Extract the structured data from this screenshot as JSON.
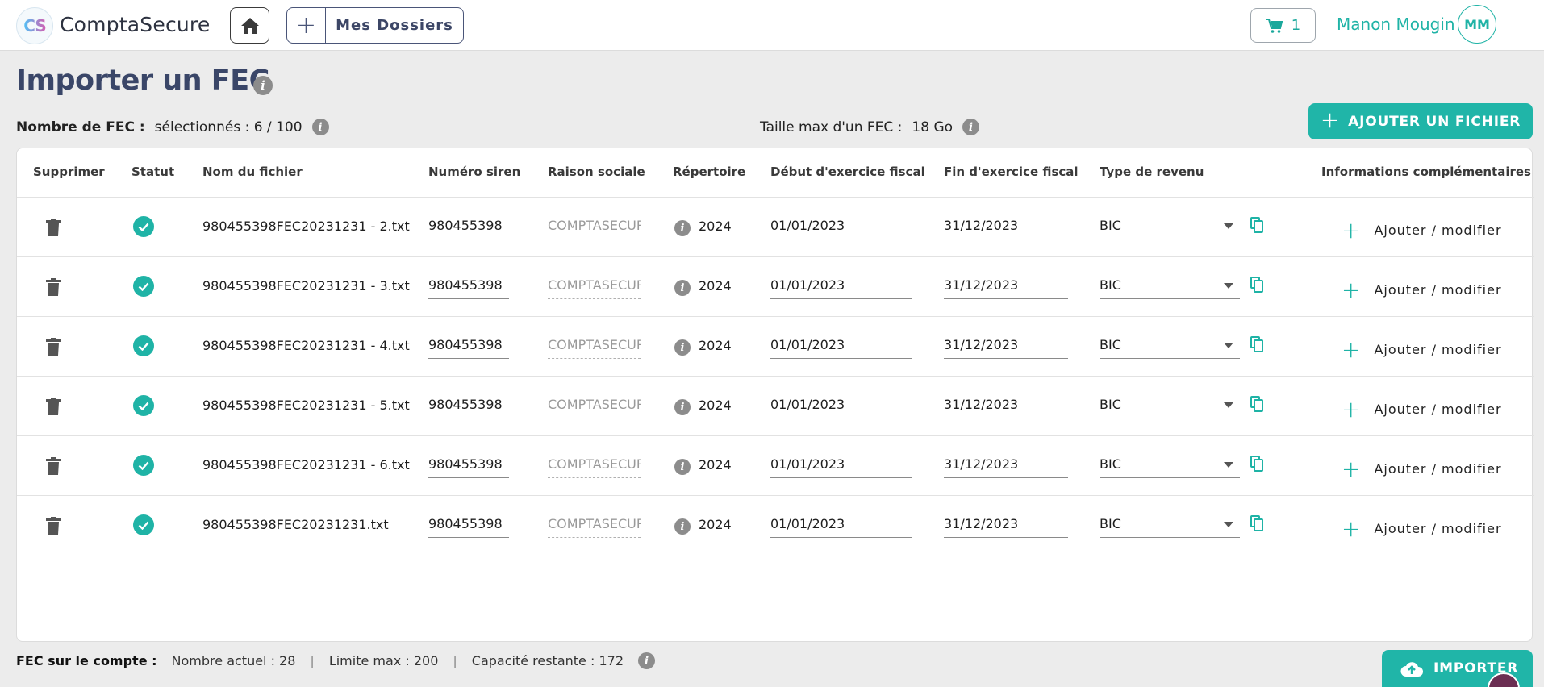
{
  "header": {
    "logo_text": "CS",
    "brand": "ComptaSecure",
    "dossiers_label": "Mes Dossiers",
    "cart_count": "1",
    "user_name": "Manon Mougin",
    "user_initials": "MM"
  },
  "page": {
    "title": "Importer un FEC",
    "fec_count_label": "Nombre de FEC :",
    "fec_count_value": "sélectionnés : 6 / 100",
    "max_size_label": "Taille max d'un FEC :",
    "max_size_value": "18 Go",
    "add_file_label": "AJOUTER UN FICHIER"
  },
  "table": {
    "headers": {
      "delete": "Supprimer",
      "status": "Statut",
      "filename": "Nom du fichier",
      "siren": "Numéro siren",
      "raison": "Raison sociale",
      "repertoire": "Répertoire",
      "debut": "Début d'exercice fiscal",
      "fin": "Fin d'exercice fiscal",
      "revenu": "Type de revenu",
      "infos": "Informations complémentaires"
    },
    "rows": [
      {
        "filename": "980455398FEC20231231 - 2.txt",
        "siren": "980455398",
        "raison": "COMPTASECURE",
        "repertoire": "2024",
        "debut": "01/01/2023",
        "fin": "31/12/2023",
        "revenu": "BIC",
        "action": "Ajouter / modifier"
      },
      {
        "filename": "980455398FEC20231231 - 3.txt",
        "siren": "980455398",
        "raison": "COMPTASECURE",
        "repertoire": "2024",
        "debut": "01/01/2023",
        "fin": "31/12/2023",
        "revenu": "BIC",
        "action": "Ajouter / modifier"
      },
      {
        "filename": "980455398FEC20231231 - 4.txt",
        "siren": "980455398",
        "raison": "COMPTASECURE",
        "repertoire": "2024",
        "debut": "01/01/2023",
        "fin": "31/12/2023",
        "revenu": "BIC",
        "action": "Ajouter / modifier"
      },
      {
        "filename": "980455398FEC20231231 - 5.txt",
        "siren": "980455398",
        "raison": "COMPTASECURE",
        "repertoire": "2024",
        "debut": "01/01/2023",
        "fin": "31/12/2023",
        "revenu": "BIC",
        "action": "Ajouter / modifier"
      },
      {
        "filename": "980455398FEC20231231 - 6.txt",
        "siren": "980455398",
        "raison": "COMPTASECURE",
        "repertoire": "2024",
        "debut": "01/01/2023",
        "fin": "31/12/2023",
        "revenu": "BIC",
        "action": "Ajouter / modifier"
      },
      {
        "filename": "980455398FEC20231231.txt",
        "siren": "980455398",
        "raison": "COMPTASECURE",
        "repertoire": "2024",
        "debut": "01/01/2023",
        "fin": "31/12/2023",
        "revenu": "BIC",
        "action": "Ajouter / modifier"
      }
    ]
  },
  "footer": {
    "label": "FEC sur le compte :",
    "current": "Nombre actuel : 28",
    "limit": "Limite max : 200",
    "remaining": "Capacité restante : 172",
    "separator": "|",
    "import_label": "IMPORTER"
  },
  "colors": {
    "accent": "#20b5a8",
    "title": "#3a4668"
  }
}
